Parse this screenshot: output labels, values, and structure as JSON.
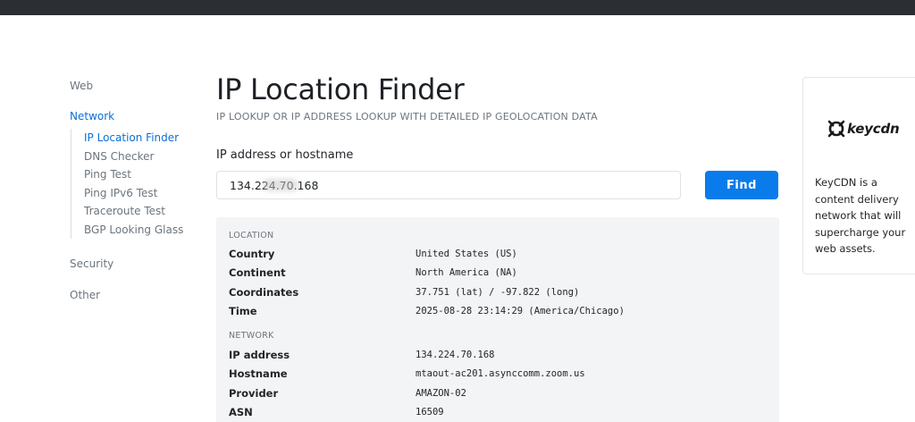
{
  "sidebar": {
    "groups": [
      {
        "label": "Web"
      },
      {
        "label": "Network",
        "active": true,
        "items": [
          {
            "label": "IP Location Finder",
            "active": true
          },
          {
            "label": "DNS Checker"
          },
          {
            "label": "Ping Test"
          },
          {
            "label": "Ping IPv6 Test"
          },
          {
            "label": "Traceroute Test"
          },
          {
            "label": "BGP Looking Glass"
          }
        ]
      },
      {
        "label": "Security"
      },
      {
        "label": "Other"
      }
    ]
  },
  "main": {
    "title": "IP Location Finder",
    "subtitle": "IP LOOKUP OR IP ADDRESS LOOKUP WITH DETAILED IP GEOLOCATION DATA",
    "field_label": "IP address or hostname",
    "input_value": "134.224.70.168",
    "find_button": "Find"
  },
  "results": {
    "location": {
      "label": "LOCATION",
      "rows": [
        {
          "key": "Country",
          "value": "United States (US)"
        },
        {
          "key": "Continent",
          "value": "North America (NA)"
        },
        {
          "key": "Coordinates",
          "value": "37.751 (lat) / -97.822 (long)"
        },
        {
          "key": "Time",
          "value": "2025-08-28 23:14:29 (America/Chicago)"
        }
      ]
    },
    "network": {
      "label": "NETWORK",
      "rows": [
        {
          "key": "IP address",
          "value": "134.224.70.168"
        },
        {
          "key": "Hostname",
          "value": "mtaout-ac201.asynccomm.zoom.us"
        },
        {
          "key": "Provider",
          "value": "AMAZON-02"
        },
        {
          "key": "ASN",
          "value": "16509"
        }
      ]
    }
  },
  "ad": {
    "logo_text": "keycdn",
    "logo_icon": "keycdn-logo-icon",
    "text": "KeyCDN is a content delivery network that will supercharge your web assets."
  },
  "colors": {
    "accent": "#0a7bea",
    "link_active": "#0a6fd6",
    "topbar": "#2b2e33",
    "panel": "#f3f4f6"
  }
}
